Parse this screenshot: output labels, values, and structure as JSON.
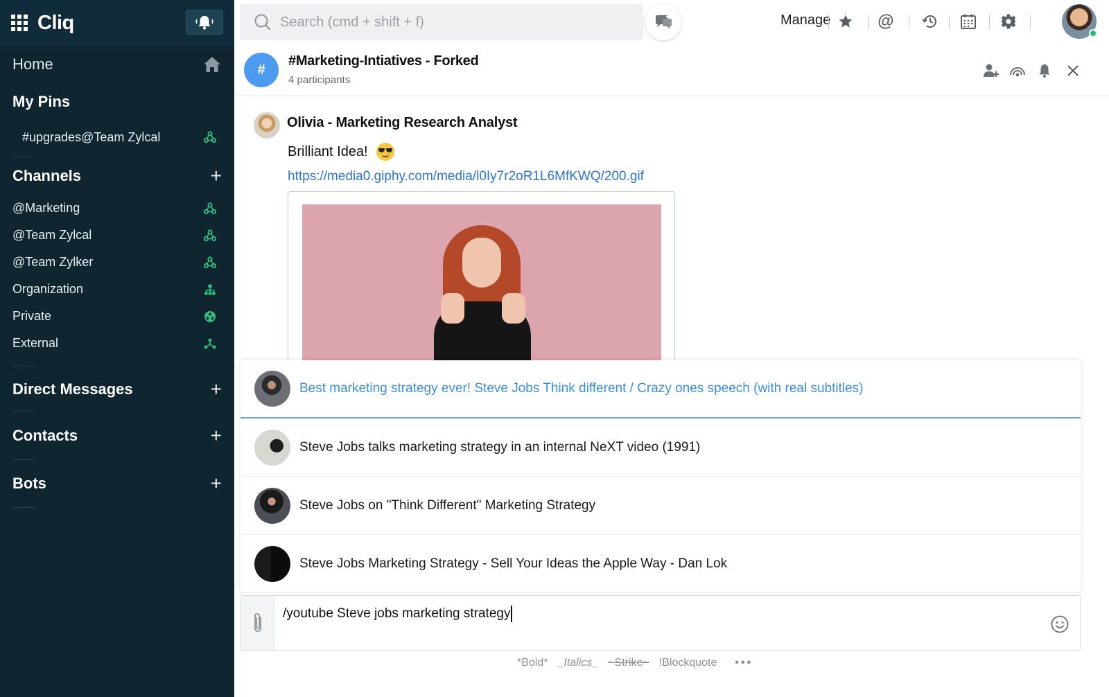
{
  "app": {
    "name": "Cliq"
  },
  "sidebar": {
    "home_label": "Home",
    "pins_title": "My Pins",
    "pins": [
      {
        "label": "#upgrades@Team Zylcal",
        "icon": "team-icon"
      }
    ],
    "channels_title": "Channels",
    "channels": [
      {
        "label": "@Marketing",
        "icon": "team-icon"
      },
      {
        "label": "@Team Zylcal",
        "icon": "team-icon"
      },
      {
        "label": "@Team Zylker",
        "icon": "team-icon"
      },
      {
        "label": "Organization",
        "icon": "org-icon"
      },
      {
        "label": "Private",
        "icon": "private-icon"
      },
      {
        "label": "External",
        "icon": "external-icon"
      }
    ],
    "dm_title": "Direct Messages",
    "contacts_title": "Contacts",
    "bots_title": "Bots",
    "accent_color": "#2ec27e"
  },
  "topbar": {
    "search_placeholder": "Search (cmd + shift + f)",
    "manage_label": "Manage"
  },
  "chat": {
    "channel_avatar": "#",
    "title": "#Marketing-Intiatives - Forked",
    "participants": "4 participants",
    "message": {
      "sender": "Olivia - Marketing Research  Analyst",
      "text": "Brilliant Idea!",
      "emoji": "sunglasses-face",
      "link": "https://media0.giphy.com/media/l0Iy7r2oR1L6MfKWQ/200.gif"
    }
  },
  "suggestions": [
    {
      "title": "Best marketing strategy ever! Steve Jobs Think different / Crazy ones speech (with real subtitles)",
      "active": true
    },
    {
      "title": "Steve Jobs talks marketing strategy in an internal NeXT video (1991)",
      "active": false
    },
    {
      "title": "Steve Jobs on \"Think Different\" Marketing Strategy",
      "active": false
    },
    {
      "title": "Steve Jobs Marketing Strategy - Sell Your Ideas the Apple Way - Dan Lok",
      "active": false
    }
  ],
  "composer": {
    "value": "/youtube Steve jobs marketing strategy"
  },
  "format_bar": {
    "bold": "*Bold*",
    "italics": "_Italics_",
    "strike": "~Strike~",
    "blockquote": "!Blockquote",
    "more": "•••"
  },
  "colors": {
    "sidebar_bg": "#0f2530",
    "link": "#2a74d4",
    "active_suggestion": "#3b8ee0",
    "channel_avatar": "#4c9bef"
  }
}
